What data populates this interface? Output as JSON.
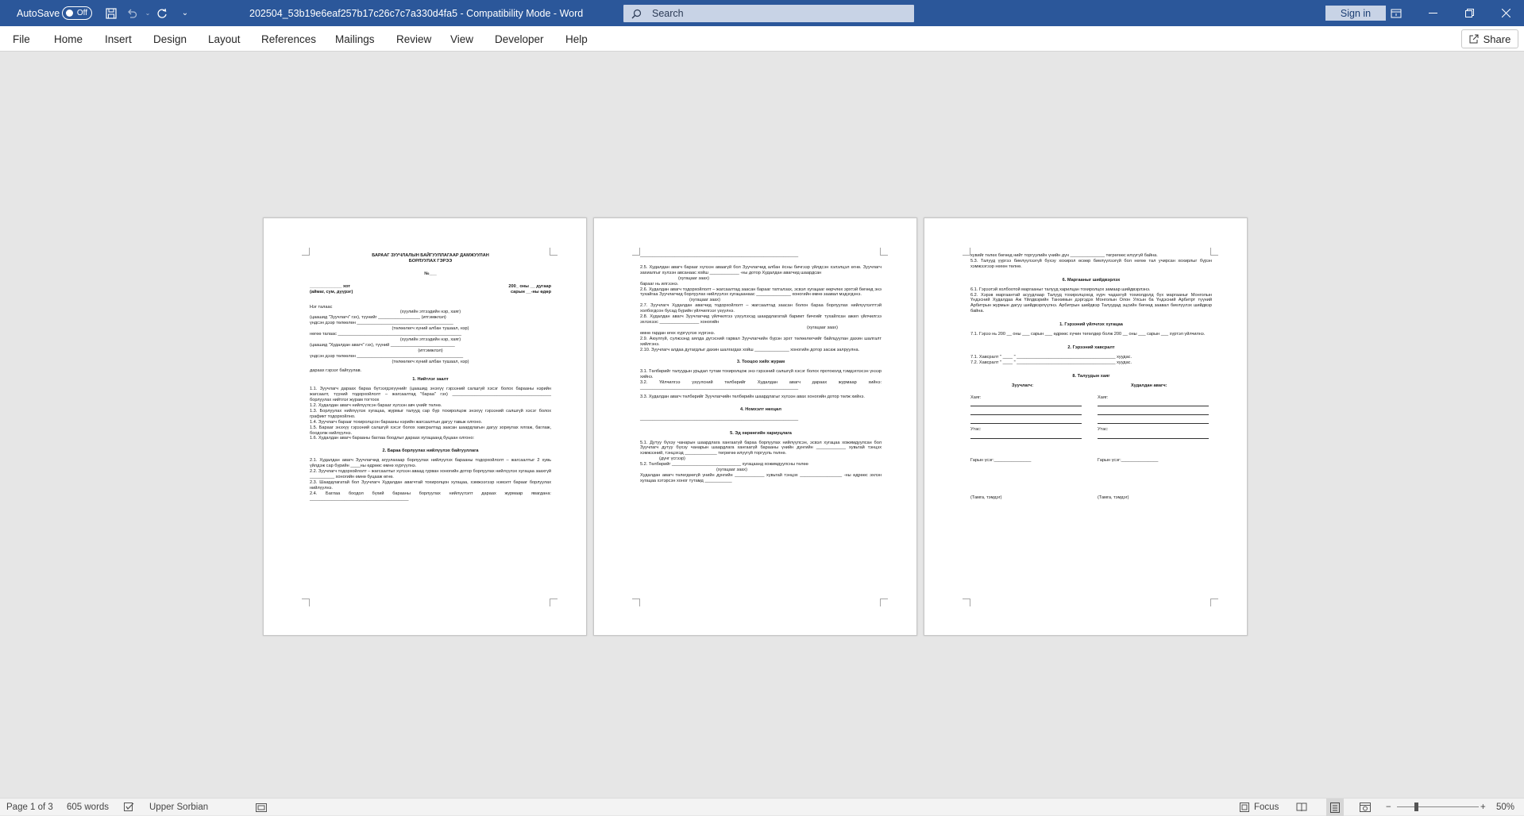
{
  "titlebar": {
    "autosave_label": "AutoSave",
    "autosave_state": "Off",
    "doc_title": "202504_53b19e6eaf257b17c26c7c7a330d4fa5  -  Compatibility Mode  -  Word",
    "search_placeholder": "Search",
    "signin_label": "Sign in",
    "icons": [
      "save-icon",
      "undo-icon",
      "redo-icon",
      "customize-qat-icon",
      "ribbon-display-icon",
      "minimize-icon",
      "restore-icon",
      "close-icon"
    ]
  },
  "menu": {
    "items": [
      "File",
      "Home",
      "Insert",
      "Design",
      "Layout",
      "References",
      "Mailings",
      "Review",
      "View",
      "Developer",
      "Help"
    ],
    "share_label": "Share"
  },
  "colors": {
    "titlebar": "#2b579a",
    "canvas": "#e6e6e6"
  },
  "page1": {
    "title1": "БАРААГ ЗУУЧЛАЛЫН БАЙГУУЛЛАГААР ДАМЖУУЛАН",
    "title2": "БОРЛУУЛАХ ГЭРЭЭ",
    "no": "№___",
    "left1": "_____________ хот",
    "right1": "200_ оны __ дугаар",
    "left2": "(аймаг, сум, дүүрэг)",
    "right2": "сарын __-ны өдөр",
    "p1": "Нэг талаас",
    "p2": "(хуулийн этгээдийн нэр, хаяг)",
    "p3": "(цаашид \"Зуучлагч\" гэх), түүнийг _________________ (итгэмжлэл)",
    "p4": "үндсэн дээр төлөөлөн _______________________________________",
    "p5": "(төлөөлөгч хүний албан тушаал, нэр)",
    "p6": "нөгөө талаас __________________________________________________",
    "p7": "(хуулийн этгээдийн нэр, хаяг)",
    "p8": "(цаашид \"Худалдан авагч\" гэх), түүний __________________________",
    "p9": "(итгэмжлэл)",
    "p10": "үндсэн дээр төлөөлөн ___________________________________________",
    "p11": "(төлөөлөгч хүний албан тушаал, нэр)",
    "p12": "дараах гэрээг байгуулав.",
    "h1": "1.  Нийтлэг заалт",
    "s1_1": "1.1. Зуучлагч дараах бараа бүтээгдэхүүнийг (цаашид энэхүү гэрээний салшгүй хэсэг болох барааны нэрийн жагсаалт, түүний тодорхойлолт – жагсаалтад \"бараа\" гэх) ________________________________________ борлуулах нийтлэг журам тогтоох",
    "s1_1b": "борлуулах нийтлэг журам тогтоох",
    "s1_2": "1.2. Худалдан авагч нийлүүлсэн барааг хүлээн авч үнийг төлнө.",
    "s1_3": "1.3. Борлуулах нийлүүлэх хугацаа, журмыг талууд сар бүр тохиролцож энэхүү гэрээний салшгүй хэсэг болох графикт тодорхойлно.",
    "s1_4": "1.4. Зуучлагч барааг тохиролцсон барааны нэрийн жагсаалтын дагуу тавьж олгоно.",
    "s1_5": "1.5. Барааг энэхүү гэрээний салшгүй хэсэг болох хавсралтад заасан шаардлагын дагуу зориулах ялгаж, баглаж, боодолж нийлүүлнэ.",
    "s1_6": "1.6. Худалдан авагч барааны баглаа боодлыг дараах хугацаанд буцаан олгоно:",
    "h2": "2.  Бараа борлуулах нийлүүлэх байгууллага",
    "s2_1": "2.1. Худалдан авагч Зуучлагчид агуулахаар борлуулах нийлүүлэх барааны тодорхойлолт – жагсаалтыг 2 хувь үйлдэж сар бүрийн ____ны өдрөөс өмнө хүргүүлнэ.",
    "s2_2": "2.2. Зуучлагч тодорхойлолт – жагсаалтыг хүлээн аваад гурван хоногийн дотор борлуулах нийлүүлэх хугацаа заахгүй __________ хоногийн өмнө буцааж өгнө.",
    "s2_3": "2.3. Шаардлагатай бол Зуучлагч Худалдан авагчтай тохиролцон хугацаа, хэмжээгээр нэмэлт барааг борлуулах нийлүүлнэ.",
    "s2_4": "2.4. Баглаа боодол бүхий барааны борлуулах нийлүүлэлт дараах журмаар явагдана: ________________________________________"
  },
  "page2": {
    "line0": "________________________________________________________________",
    "s2_5": "2.5. Худалдан авагч барааг хүлээн аваагүй бол Зуучлагчид албан ёсны бичгээр үйлдсэн хэлэлцэл өгнө. Зуучлагч захиалгыг хүлээн авсанаас хойш ____________ -ны дотор Худалдан авагчид шаардсан",
    "s2_5b": "(хугацааг заах)",
    "s2_5c": "барааг нь илгээнэ.",
    "s2_6": "2.6. Худалдан авагч тодорхойлолт – жагсаалтад заасан барааг татгалзах, эсвэл хугацааг өөрчлөх эрхтэй бөгөөд энэ тухайгаа Зуучлагчид борлуулах нийлүүлэх хугацаанаас ______________ хоногийн өмнө заавал мэдэгдэнэ.",
    "s2_6b": "(хугацааг заах)",
    "s2_7": "2.7. Зуучлагч Худалдан авагчид тодорхойлолт – жагсаалтад заасан болон бараа борлуулах нийлүүлэлттэй холбогдсон бусад бүрийн үйлчилгээг үзүүлнэ.",
    "s2_8": "2.8. Худалдан авагч Зуучлагчид үйлчилгээ үзүүлэхэд шаардлагатай баримт бичгийг тухайлсан ажил үйлчилгээ эхлэхээс ________________ хоногийн",
    "s2_8b": "(хугацааг заах)",
    "s2_8c": "өмнө гардан өгөх хүргүүлэх хүргэнэ.",
    "s2_9": "2.9. Аюулгүй, сүлжээнд аялда дүгэсний гарвал Зуучлагчийн бүрэн эрхт төлөөлөгчийг байлцуулан дахин шалгалт хийлгэнэ.",
    "s2_10": "2.10. Зуучлагч алдаа дутагдлыг дахин шалгагдах хойш ______________ хоногийн дотор засаж залруулна.",
    "h3": "3.  Тооцоо хийх журам",
    "s3_1": "3.1. Төлбөрийг талуудын урьдал тутам тохиролцож энэ гэрээний салшгүй хэсэг болох протоколд тэмдэглэсэн үнээр хийнэ.",
    "s3_2": "3.2. Үйлчилгээ үзүүлсний төлбөрийг Худалдан авагч дараах журмаар хийнэ: ________________________________________________________________",
    "s3_3": "3.3. Худалдан авагч төлбөрийг Зуучлагчийн төлбөрийн шаардлагыг хүлээн авах хоногийн дотор төлж хийнэ.",
    "h4": "4.  Номхэлт нөхцөл",
    "line4": "________________________________________________________________",
    "h5": "5.  Эд хөрөнгийн хариуцлага",
    "s5_1": "5.1. Дутуу бүхэу чанарын шаардлага хангаагүй бараа борлуулах нийлүүлсэн, эсвэл хугацаа хожимдуулсан бол Зуучлагч дутуу бүхэу чанарын шаардлага хангаагүй барааны үнийн дүнгийн ____________ хувьтай тэнцэх хэмжээний, тэнцэхэд _____________ төгрөгөө илүүгүй торгууль төлнө.",
    "s5_1b": "(дүнг үсгээр)",
    "s5_2": "5.2. Төлбөрийг ____________________________ хугацаанд хожимдуулсны төлөө",
    "s5_2b": "(хугацааг заах)",
    "s5_2c": "Худалдан авагч төлөгдөөгүй үнийн дүнгийн ____________ хувьтай тэнцэх _________________ -ны өдрөөс эхлэн хугацаа хэтэрсэн хоног тутамд ___________"
  },
  "page3": {
    "c0": "хувийг төлөх бөгөөд нийт торгуулийн үнийн дүн ______________ төгрөгөөс илүүгүй байна.",
    "c0b": "5.3. Талууд үүргээ биелүүлээгүй бүхэу хохирол өсөөр биелүүлээгүй бол нөгөө тал учирсан хохирлыг бүрэн хэмжээгээр нөхөн төлнө.",
    "h6": "6. Маргааныг шийдвэрлэх",
    "s6_1": "6.1. Гэрээтэй холбоотой маргааныг талууд харилцан тохиролцох замаар шийдвэрлэнэ.",
    "s6_2": "6.2. Хэрэв маргаантай асуудлаар Талууд тохиролцоход хүрч чадахгүй тохиолдолд бүх маргааныг Монголын Үндэсний Худалдаа Аж Үйлдвэрийн Танхимын дэргэдэх Монголын Олон Улсын ба Үндэсний Арбитрт түүний Арбитрын журмын дагуу шийдвэрлүүлнэ. Арбитрын шийдвэр Талуудад эцсийн бөгөөд заавал биелүүлэх шийдвэр байна.",
    "h7": "1.  Гэрээний үйлчлэх хугацаа",
    "s7_1": "7.1. Гэрээ нь 200 __ оны ___ сарын ___ өдрөөс хүчин төгөлдөр болж 200 __ оны ___ сарын ___ хүртэл үйлчилнэ.",
    "h8": "2.  Гэрээний хавсралт",
    "s8_1": "7.1. Хавсралт \" ____ \" ________________________________________ хуудас.",
    "s8_2": "7.2. Хавсралт \" ____ \" ________________________________________ хуудас.",
    "h9": "8.  Талуудын хаяг",
    "left_title": "Зуучлагч:",
    "right_title": "Худалдан авагч:",
    "address": "Хаяг:",
    "phone": "Утас:",
    "sign": "Гарын үсэг:_______________",
    "seal": "(Тамга, тэмдэг)"
  },
  "statusbar": {
    "page": "Page 1 of 3",
    "words": "605 words",
    "language": "Upper Sorbian",
    "focus": "Focus",
    "zoom": "50%",
    "zoom_minus": "−",
    "zoom_plus": "+"
  }
}
